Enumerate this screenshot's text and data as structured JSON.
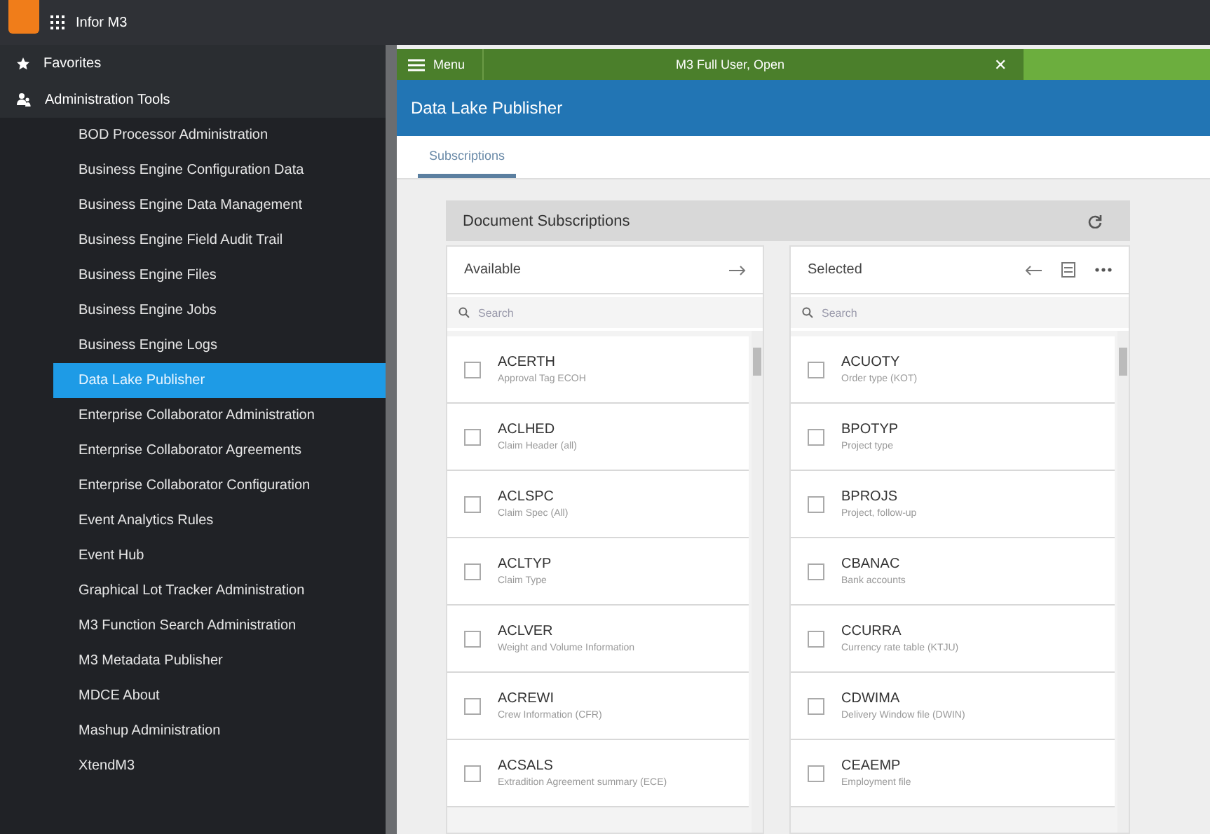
{
  "app_title": "Infor M3",
  "sidebar": {
    "sections": [
      {
        "label": "Favorites",
        "kind": "star"
      },
      {
        "label": "Administration Tools",
        "kind": "users"
      }
    ],
    "items": [
      {
        "label": "BOD Processor Administration",
        "selected": false
      },
      {
        "label": "Business Engine Configuration Data",
        "selected": false
      },
      {
        "label": "Business Engine Data Management",
        "selected": false
      },
      {
        "label": "Business Engine Field Audit Trail",
        "selected": false
      },
      {
        "label": "Business Engine Files",
        "selected": false
      },
      {
        "label": "Business Engine Jobs",
        "selected": false
      },
      {
        "label": "Business Engine Logs",
        "selected": false
      },
      {
        "label": "Data Lake Publisher",
        "selected": true
      },
      {
        "label": "Enterprise Collaborator Administration",
        "selected": false
      },
      {
        "label": "Enterprise Collaborator Agreements",
        "selected": false
      },
      {
        "label": "Enterprise Collaborator Configuration",
        "selected": false
      },
      {
        "label": "Event Analytics Rules",
        "selected": false
      },
      {
        "label": "Event Hub",
        "selected": false
      },
      {
        "label": "Graphical Lot Tracker Administration",
        "selected": false
      },
      {
        "label": "M3 Function Search Administration",
        "selected": false
      },
      {
        "label": "M3 Metadata Publisher",
        "selected": false
      },
      {
        "label": "MDCE About",
        "selected": false
      },
      {
        "label": "Mashup Administration",
        "selected": false
      },
      {
        "label": "XtendM3",
        "selected": false
      }
    ]
  },
  "menu_bar": {
    "menu": "Menu",
    "tab_title": "M3 Full User, Open",
    "close": "✕"
  },
  "page_title": "Data Lake Publisher",
  "tabs": [
    {
      "label": "Subscriptions",
      "selected": true
    }
  ],
  "panel": {
    "title": "Document Subscriptions",
    "available": {
      "title": "Available",
      "search_placeholder": "Search",
      "rows": [
        {
          "code": "ACERTH",
          "description": "Approval Tag ECOH",
          "checked": false
        },
        {
          "code": "ACLHED",
          "description": "Claim Header (all)",
          "checked": false
        },
        {
          "code": "ACLSPC",
          "description": "Claim Spec (All)",
          "checked": false
        },
        {
          "code": "ACLTYP",
          "description": "Claim Type",
          "checked": false
        },
        {
          "code": "ACLVER",
          "description": "Weight and Volume Information",
          "checked": false
        },
        {
          "code": "ACREWI",
          "description": "Crew Information (CFR)",
          "checked": false
        },
        {
          "code": "ACSALS",
          "description": "Extradition Agreement summary (ECE)",
          "checked": false
        }
      ]
    },
    "selected": {
      "title": "Selected",
      "search_placeholder": "Search",
      "rows": [
        {
          "code": "ACUOTY",
          "description": "Order type (KOT)",
          "checked": false
        },
        {
          "code": "BPOTYP",
          "description": "Project type",
          "checked": false
        },
        {
          "code": "BPROJS",
          "description": "Project, follow-up",
          "checked": false
        },
        {
          "code": "CBANAC",
          "description": "Bank accounts",
          "checked": false
        },
        {
          "code": "CCURRA",
          "description": "Currency rate table (KTJU)",
          "checked": false
        },
        {
          "code": "CDWIMA",
          "description": "Delivery Window file (DWIN)",
          "checked": false
        },
        {
          "code": "CEAEMP",
          "description": "Employment file",
          "checked": false
        }
      ]
    }
  }
}
